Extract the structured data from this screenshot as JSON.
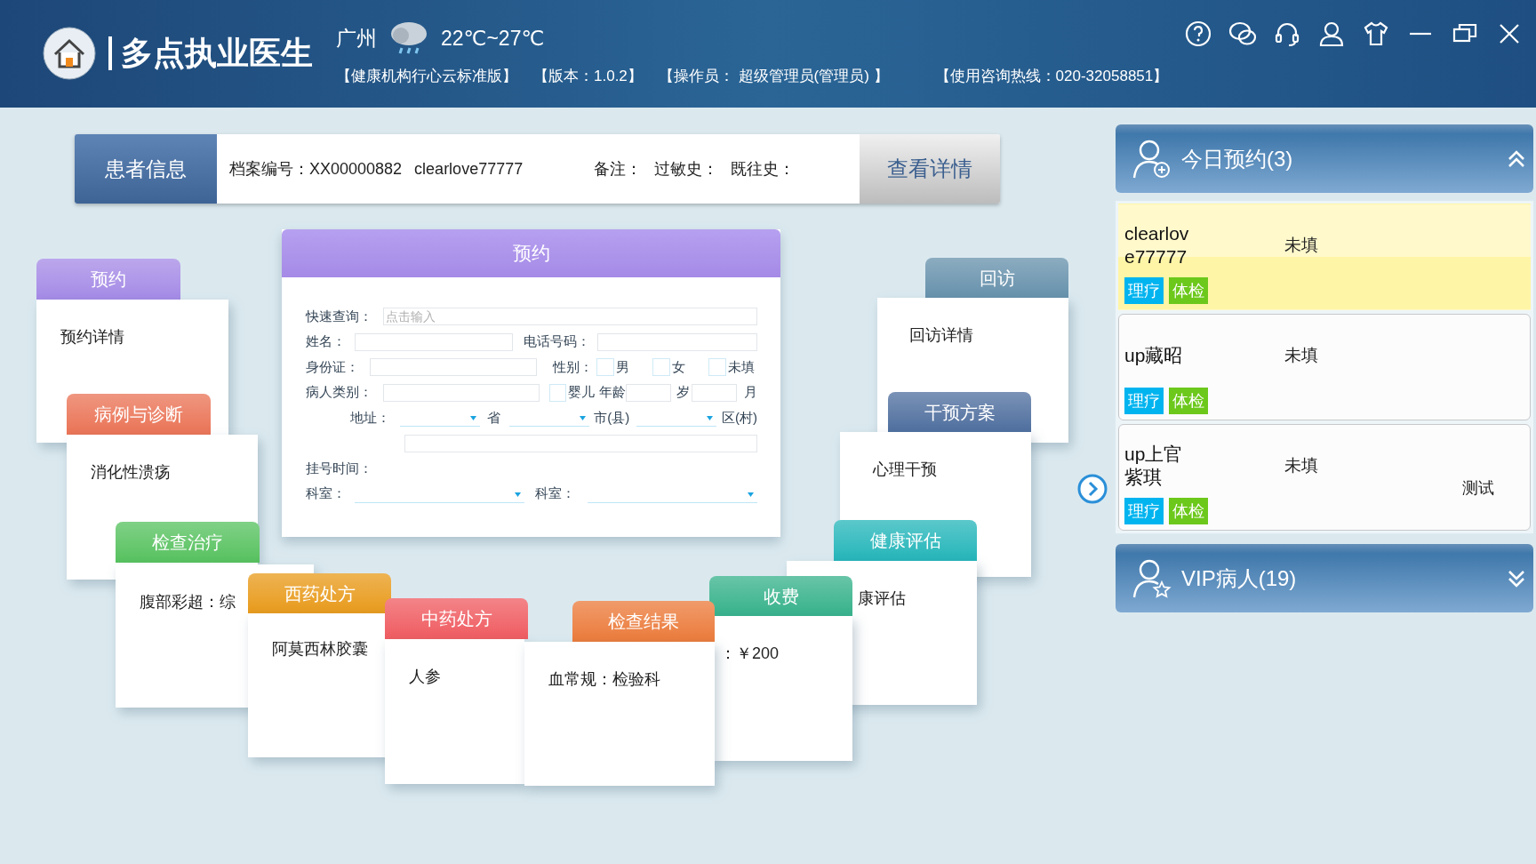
{
  "header": {
    "title": "多点执业医生",
    "city": "广州",
    "temperature": "22℃~27℃",
    "info": [
      "【健康机构行心云标准版】",
      "【版本：1.0.2】",
      "【操作员： 超级管理员(管理员) 】",
      "【使用咨询热线：020-32058851】"
    ]
  },
  "patient_bar": {
    "label": "患者信息",
    "record": "档案编号：XX00000882",
    "name": "clearlove77777",
    "fields": [
      "备注：",
      "过敏史：",
      "既往史："
    ],
    "button": "查看详情"
  },
  "form": {
    "title": "预约",
    "quick_search": {
      "label": "快速查询：",
      "placeholder": "点击输入"
    },
    "name_label": "姓名：",
    "phone_label": "电话号码：",
    "id_label": "身份证：",
    "gender_label": "性别：",
    "genders": [
      {
        "label": "男",
        "checked": false
      },
      {
        "label": "女",
        "checked": false
      },
      {
        "label": "未填",
        "checked": false
      }
    ],
    "type_label": "病人类别：",
    "infant": {
      "label": "婴儿",
      "checked": false
    },
    "age_label": "年龄",
    "years": "岁",
    "months": "月",
    "address_label": "地址：",
    "address_units": [
      "省",
      "市(县)",
      "区(村)"
    ],
    "reg_time_label": "挂号时间：",
    "dept_labels": [
      "科室：",
      "科室："
    ]
  },
  "cards": [
    {
      "title": "预约",
      "content": "预约详情",
      "color": "#a48ae6"
    },
    {
      "title": "病例与诊断",
      "content": "消化性溃疡",
      "color": "#ea7355"
    },
    {
      "title": "检查治疗",
      "content": "腹部彩超：综",
      "color": "#56c15e"
    },
    {
      "title": "西药处方",
      "content": "阿莫西林胶囊",
      "color": "#e89a1a"
    },
    {
      "title": "中药处方",
      "content": "人参",
      "color": "#ef5b60"
    },
    {
      "title": "回访",
      "content": "回访详情",
      "color": "#6590ab"
    },
    {
      "title": "干预方案",
      "content": "心理干预",
      "color": "#4e6e9e"
    },
    {
      "title": "健康评估",
      "content": "康评估",
      "color": "#24b5b9"
    },
    {
      "title": "收费",
      "content": "：￥200",
      "color": "#35b18a"
    },
    {
      "title": "检查结果",
      "content": "血常规：检验科",
      "color": "#eb7a3a"
    }
  ],
  "today": {
    "title": "今日预约(3)",
    "items": [
      {
        "name": "clearlove77777",
        "status": "未填",
        "selected": true,
        "tags": [
          {
            "label": "理疗",
            "color": "#00b4ef"
          },
          {
            "label": "体检",
            "color": "#6cc81b"
          }
        ]
      },
      {
        "name": "up藏昭",
        "status": "未填",
        "selected": false,
        "tags": [
          {
            "label": "理疗",
            "color": "#00b4ef"
          },
          {
            "label": "体检",
            "color": "#6cc81b"
          }
        ]
      },
      {
        "name": "up上官紫琪",
        "status": "未填",
        "note": "测试",
        "selected": false,
        "tags": [
          {
            "label": "理疗",
            "color": "#00b4ef"
          },
          {
            "label": "体检",
            "color": "#6cc81b"
          }
        ]
      }
    ]
  },
  "vip": {
    "title": "VIP病人(19)"
  }
}
